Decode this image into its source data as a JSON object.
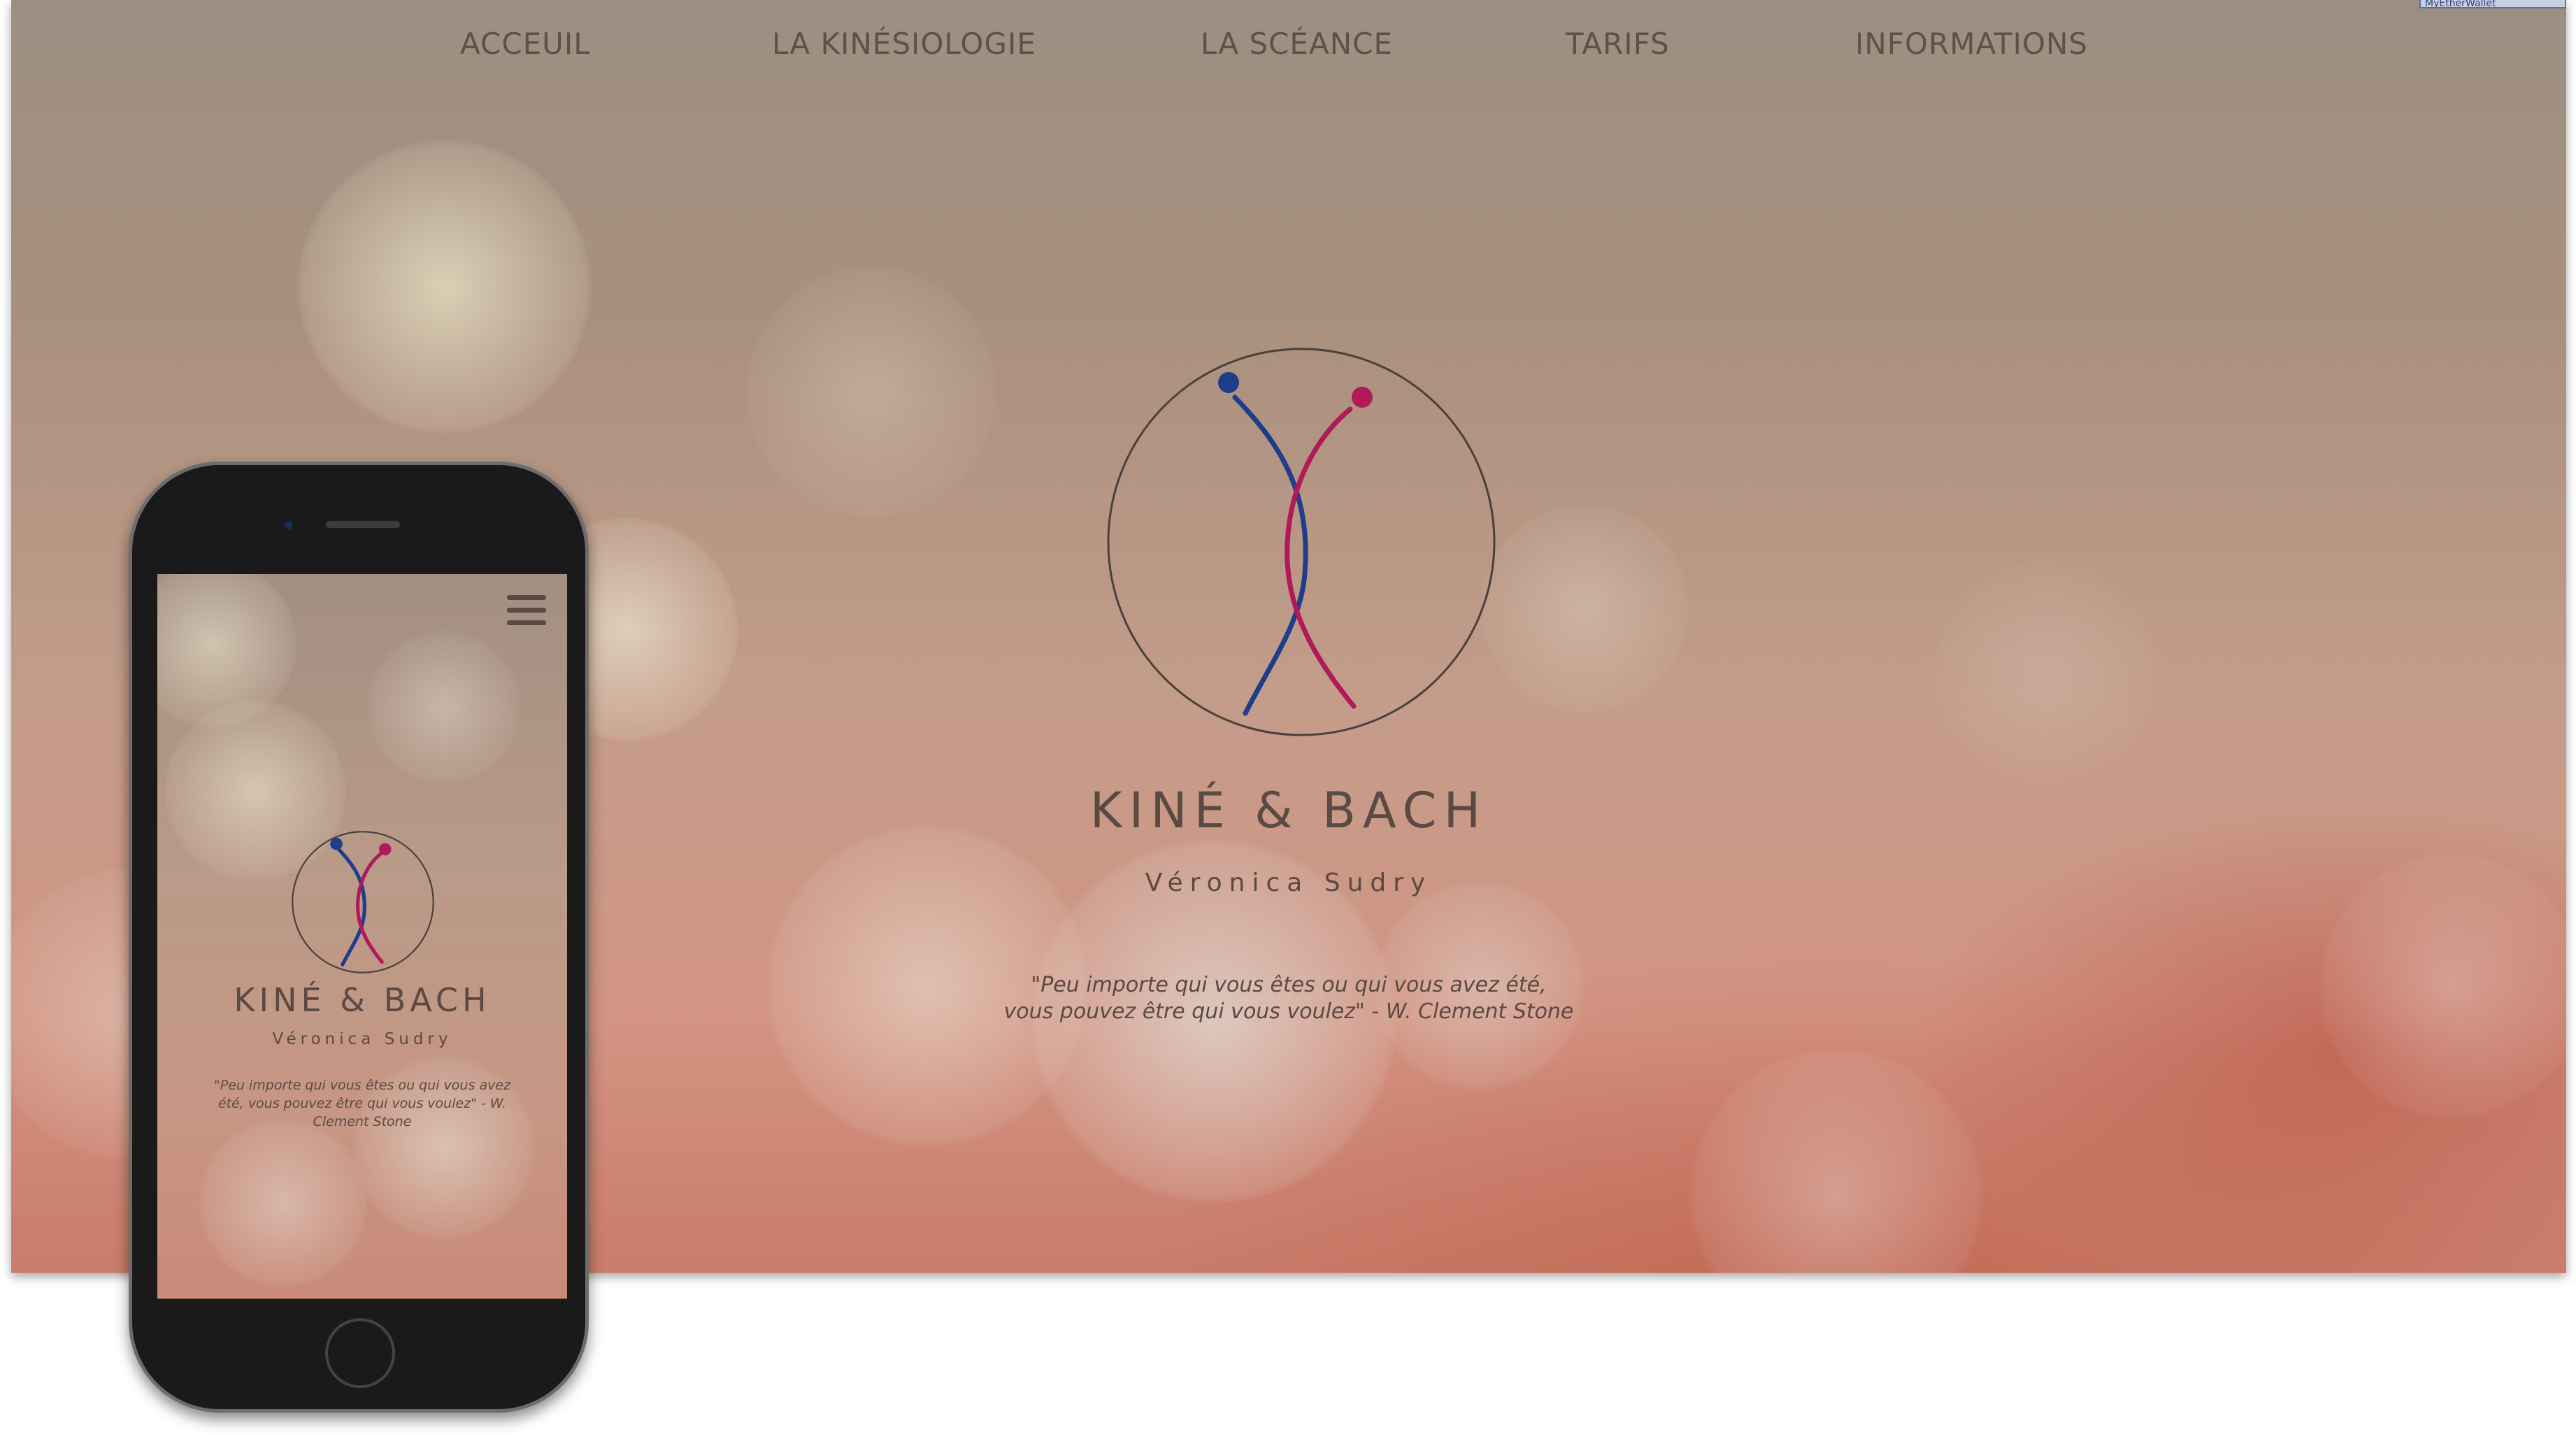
{
  "nav": {
    "items": [
      {
        "label": "ACCEUIL"
      },
      {
        "label": "LA KINÉSIOLOGIE"
      },
      {
        "label": "LA SCÉANCE"
      },
      {
        "label": "TARIFS"
      },
      {
        "label": "INFORMATIONS"
      }
    ]
  },
  "corner_tab": {
    "label": "MyEtherWallet"
  },
  "brand": {
    "title": "KINÉ & BACH",
    "subtitle": "Véronica Sudry",
    "quote_line1": "\"Peu  importe qui vous êtes ou qui vous avez été,",
    "quote_line2": "vous  pouvez  être qui vous voulez\" - W. Clement Stone"
  },
  "mobile": {
    "title": "KINÉ & BACH",
    "subtitle": "Véronica Sudry",
    "quote": "\"Peu  importe qui vous êtes ou qui vous avez été, vous  pouvez  être qui vous voulez\" - W. Clement Stone",
    "menu_icon": "hamburger-menu-icon"
  },
  "colors": {
    "text": "#5b4a43",
    "logo_blue": "#1e3d8a",
    "logo_magenta": "#b0195a"
  }
}
